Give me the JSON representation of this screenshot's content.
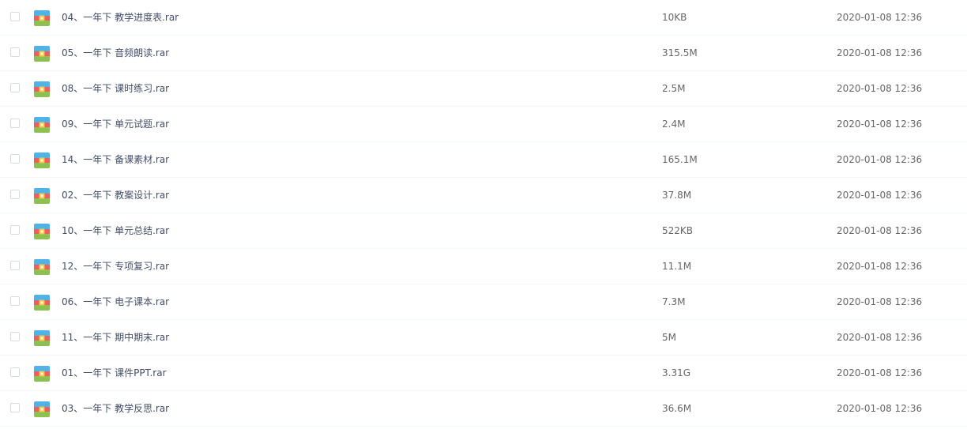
{
  "files": [
    {
      "name": "04、一年下 教学进度表.rar",
      "size": "10KB",
      "modified": "2020-01-08 12:36",
      "icon": "rar-archive-icon"
    },
    {
      "name": "05、一年下 音频朗读.rar",
      "size": "315.5M",
      "modified": "2020-01-08 12:36",
      "icon": "rar-archive-icon"
    },
    {
      "name": "08、一年下 课时练习.rar",
      "size": "2.5M",
      "modified": "2020-01-08 12:36",
      "icon": "rar-archive-icon"
    },
    {
      "name": "09、一年下 单元试题.rar",
      "size": "2.4M",
      "modified": "2020-01-08 12:36",
      "icon": "rar-archive-icon"
    },
    {
      "name": "14、一年下 备课素材.rar",
      "size": "165.1M",
      "modified": "2020-01-08 12:36",
      "icon": "rar-archive-icon"
    },
    {
      "name": "02、一年下 教案设计.rar",
      "size": "37.8M",
      "modified": "2020-01-08 12:36",
      "icon": "rar-archive-icon"
    },
    {
      "name": "10、一年下 单元总结.rar",
      "size": "522KB",
      "modified": "2020-01-08 12:36",
      "icon": "rar-archive-icon"
    },
    {
      "name": "12、一年下 专项复习.rar",
      "size": "11.1M",
      "modified": "2020-01-08 12:36",
      "icon": "rar-archive-icon"
    },
    {
      "name": "06、一年下 电子课本.rar",
      "size": "7.3M",
      "modified": "2020-01-08 12:36",
      "icon": "rar-archive-icon"
    },
    {
      "name": "11、一年下 期中期末.rar",
      "size": "5M",
      "modified": "2020-01-08 12:36",
      "icon": "rar-archive-icon"
    },
    {
      "name": "01、一年下 课件PPT.rar",
      "size": "3.31G",
      "modified": "2020-01-08 12:36",
      "icon": "rar-archive-icon"
    },
    {
      "name": "03、一年下 教学反思.rar",
      "size": "36.6M",
      "modified": "2020-01-08 12:36",
      "icon": "rar-archive-icon"
    }
  ],
  "colors": {
    "icon_band_top": "#4fb3e8",
    "icon_band_middle": "#ef5d5d",
    "icon_band_bottom": "#8cc152",
    "icon_clasp": "#f7c948",
    "row_divider": "#f2f6fd",
    "text_primary": "#424e67",
    "text_secondary": "#666666"
  }
}
